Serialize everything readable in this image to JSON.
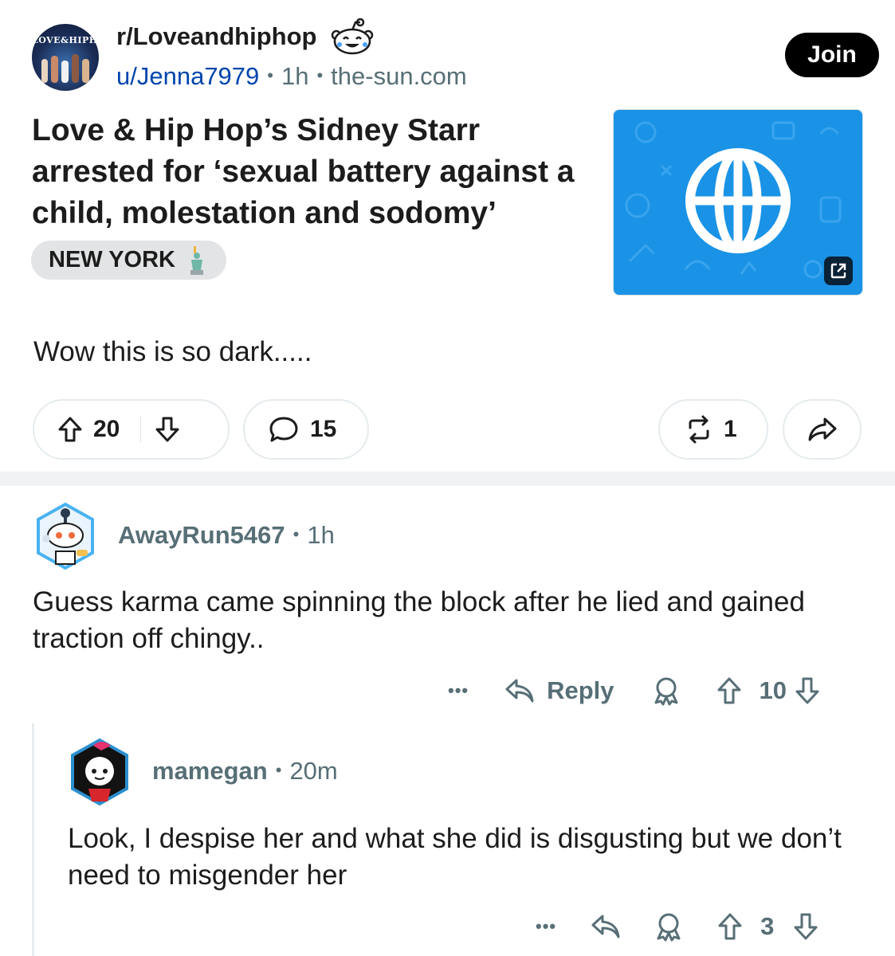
{
  "header": {
    "subreddit": "r/Loveandhiphop",
    "author": "u/Jenna7979",
    "time": "1h",
    "domain": "the-sun.com",
    "join_label": "Join",
    "sub_logo_text": "LOVE&HIPHOP"
  },
  "post": {
    "title": "Love & Hip Hop’s Sidney Starr arrested for ‘sexual battery against a child, molestation and sodomy’",
    "flair": "NEW YORK",
    "body": "Wow this is so dark.....",
    "upvotes": "20",
    "comments": "15",
    "crossposts": "1"
  },
  "comments": [
    {
      "author": "AwayRun5467",
      "time": "1h",
      "body": "Guess karma came spinning the block after he lied and gained traction off chingy..",
      "reply_label": "Reply",
      "score": "10",
      "more_label": "•••"
    },
    {
      "author": "mamegan",
      "time": "20m",
      "body": "Look, I despise her and what she did is disgusting but we don’t need to misgender her",
      "score": "3",
      "more_label": "•••"
    }
  ],
  "colors": {
    "accent_blue": "#0045ac",
    "meta_gray": "#576f76",
    "thumb_blue": "#1a93e6",
    "join_bg": "#000000"
  },
  "icons": [
    "snoo-laugh-icon",
    "statue-of-liberty-icon",
    "globe-icon",
    "external-link-icon",
    "upvote-icon",
    "downvote-icon",
    "comment-icon",
    "crosspost-icon",
    "share-icon",
    "reply-icon",
    "award-icon",
    "more-icon"
  ]
}
